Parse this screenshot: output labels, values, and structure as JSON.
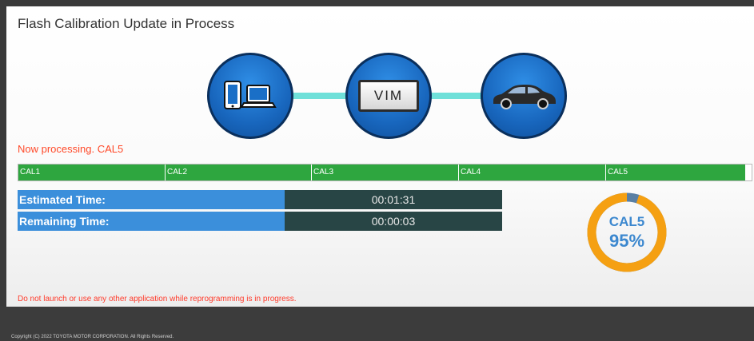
{
  "window": {
    "title": "Flash Calibration Update in Process"
  },
  "flow": {
    "device_icon": "tablet-laptop-icon",
    "vim_label": "VIM",
    "vehicle_icon": "car-icon",
    "connector_color": "#6fe0d9"
  },
  "status": {
    "now_processing": "Now processing. CAL5"
  },
  "progress": {
    "segments": [
      {
        "label": "CAL1",
        "complete": 1.0
      },
      {
        "label": "CAL2",
        "complete": 1.0
      },
      {
        "label": "CAL3",
        "complete": 1.0
      },
      {
        "label": "CAL4",
        "complete": 1.0
      },
      {
        "label": "CAL5",
        "complete": 0.95
      }
    ],
    "fill_color": "#2ea63f"
  },
  "times": {
    "estimated_label": "Estimated Time:",
    "estimated_value": "00:01:31",
    "remaining_label": "Remaining Time:",
    "remaining_value": "00:00:03"
  },
  "ring": {
    "name": "CAL5",
    "percent_text": "95%",
    "percent": 95,
    "fill_color": "#f5a012",
    "remaining_color": "#5a7fa3"
  },
  "warning": {
    "line1": "Do not launch or use any other application while reprogramming is in progress."
  },
  "footer": {
    "copyright": "Copyright (C) 2022 TOYOTA MOTOR CORPORATION. All Rights Reserved."
  }
}
